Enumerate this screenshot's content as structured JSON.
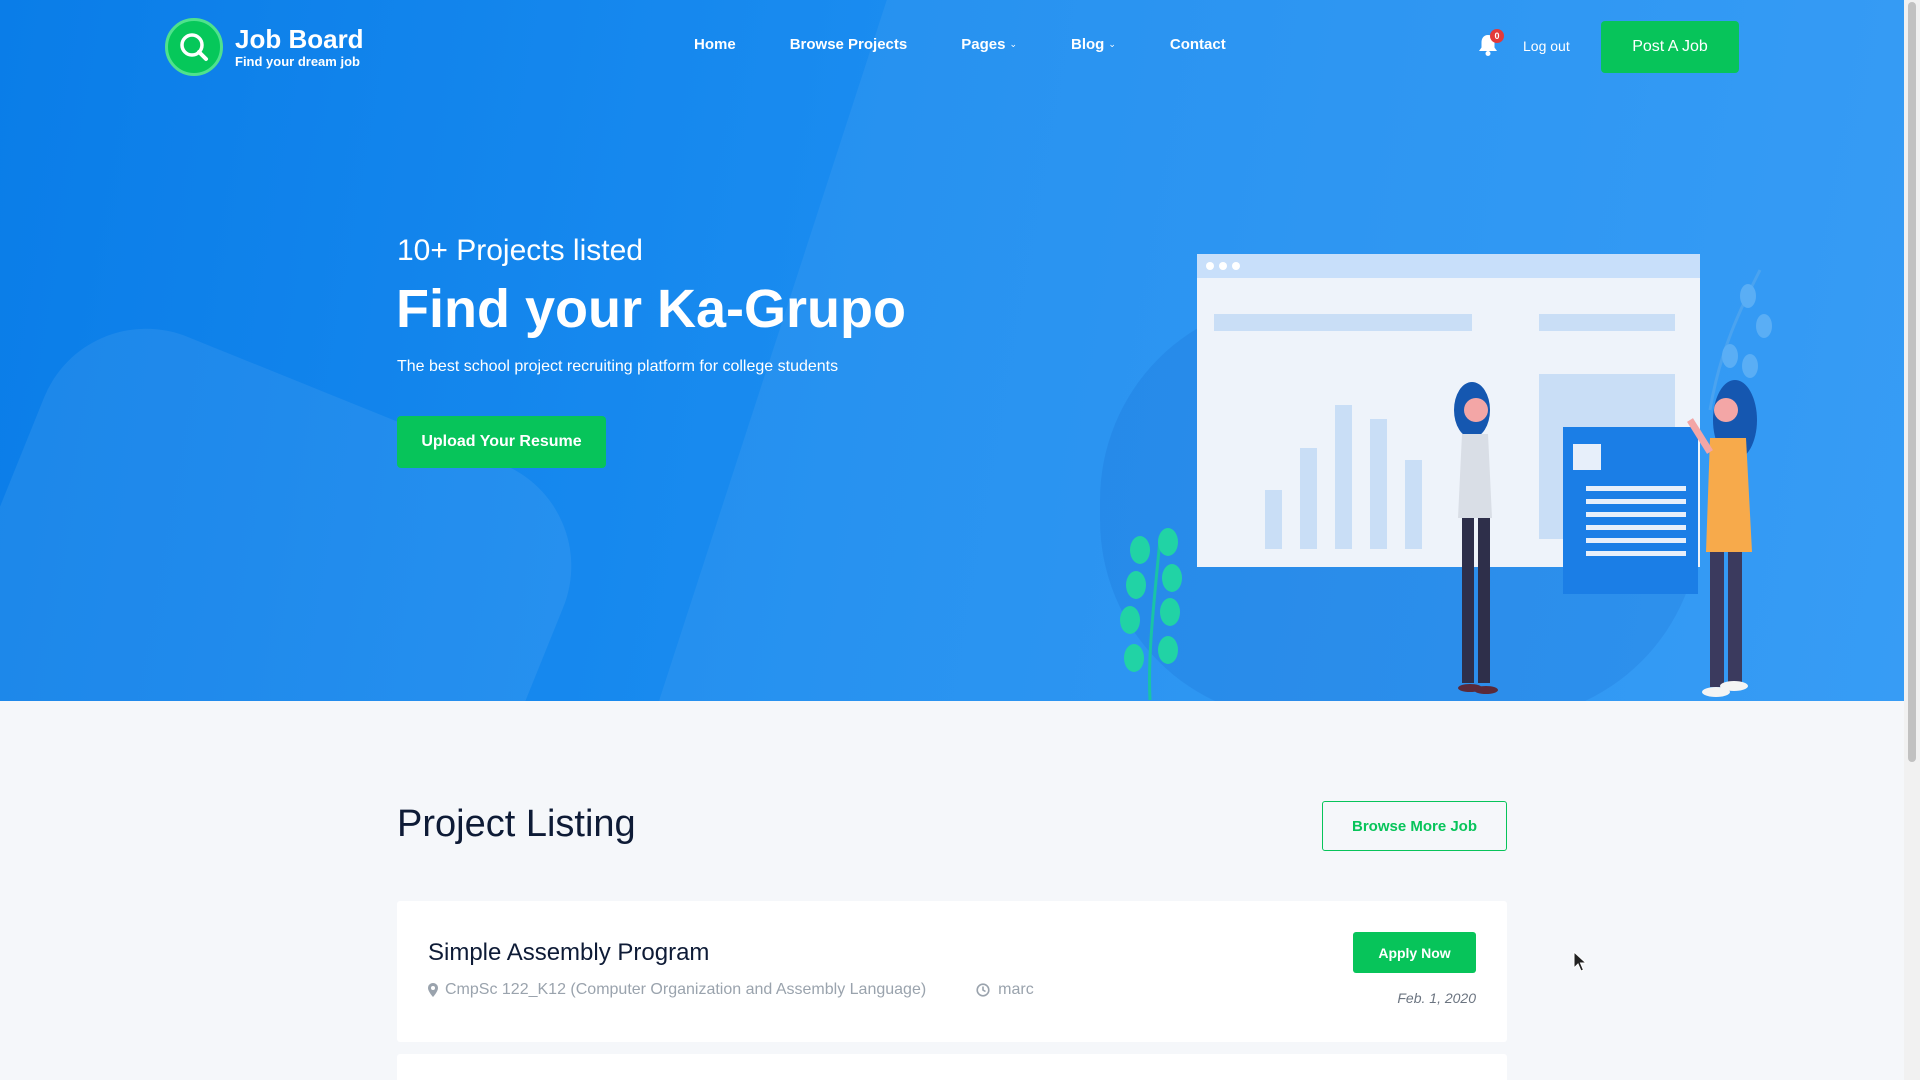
{
  "header": {
    "logo_title": "Job Board",
    "logo_subtitle": "Find your dream job",
    "nav": [
      {
        "label": "Home"
      },
      {
        "label": "Browse Projects"
      },
      {
        "label": "Pages"
      },
      {
        "label": "Blog"
      },
      {
        "label": "Contact"
      }
    ],
    "notification_count": "0",
    "logout_label": "Log out",
    "post_job_label": "Post A Job"
  },
  "hero": {
    "count_text": "10+ Projects listed",
    "title": "Find your Ka-Grupo",
    "description": "The best school project recruiting platform for college students",
    "upload_label": "Upload Your Resume"
  },
  "listing": {
    "title": "Project Listing",
    "browse_more_label": "Browse More Job",
    "items": [
      {
        "title": "Simple Assembly Program",
        "course": "CmpSc 122_K12 (Computer Organization and Assembly Language)",
        "author": "marc",
        "apply_label": "Apply Now",
        "date": "Feb. 1, 2020"
      }
    ]
  },
  "colors": {
    "accent": "#07c45a",
    "hero_blue": "#1a8cf0",
    "heading": "#0e1b36",
    "badge": "#e33a3a"
  }
}
